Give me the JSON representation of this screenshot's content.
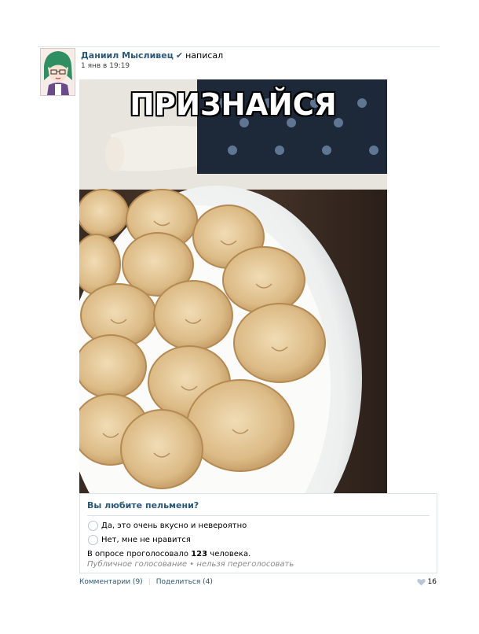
{
  "post": {
    "author": "Даниил Мысливец",
    "action": "написал",
    "date": "1 янв в 19:19"
  },
  "photo": {
    "caption": "ПРИЗНАЙСЯ"
  },
  "poll": {
    "question": "Вы любите пельмени?",
    "options": [
      "Да, это очень вкусно и невероятно",
      "Нет, мне не нравится"
    ],
    "voted_prefix": "В опросе проголосовало",
    "voted_count": "123",
    "voted_suffix": "человека.",
    "note": "Публичное голосование • нельзя переголосовать"
  },
  "footer": {
    "comments": "Комментарии (9)",
    "share": "Поделиться (4)",
    "likes": "16"
  },
  "colors": {
    "link": "#2b587a",
    "border": "#dae1e8"
  }
}
